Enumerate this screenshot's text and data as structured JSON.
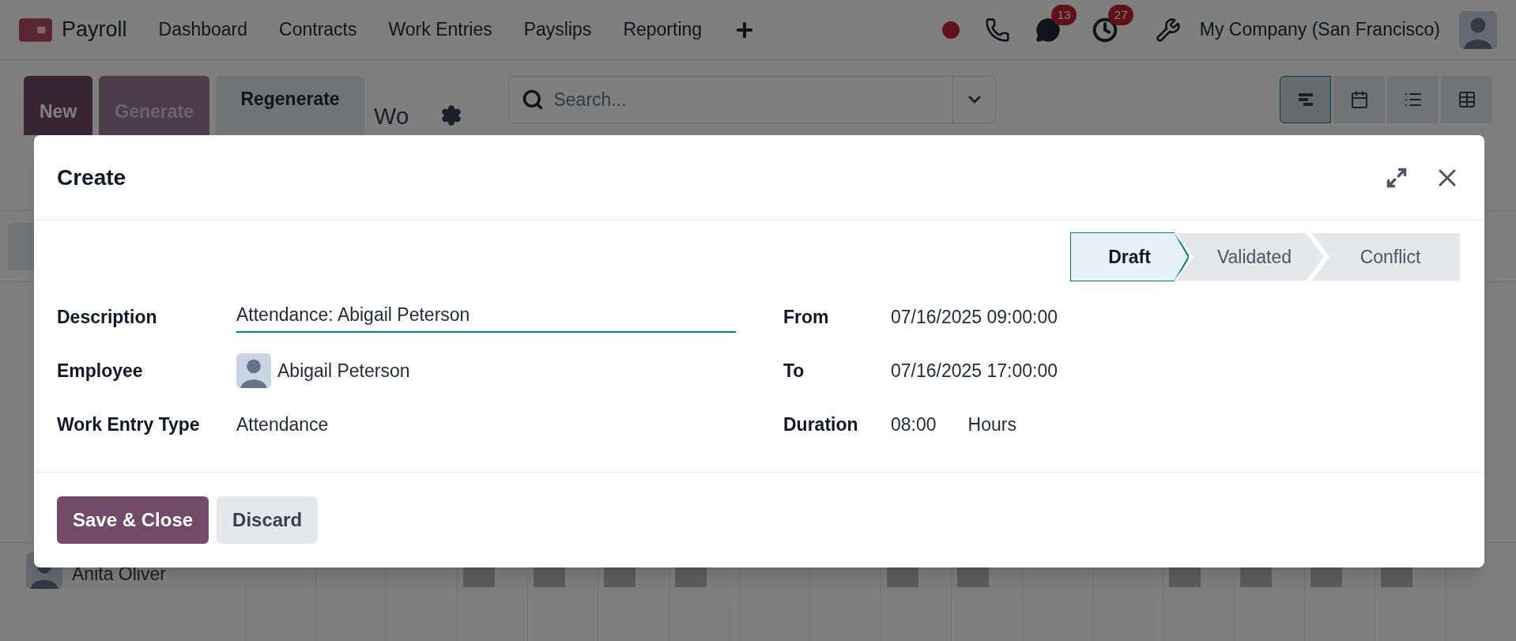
{
  "navbar": {
    "app_name": "Payroll",
    "menu": [
      {
        "label": "Dashboard"
      },
      {
        "label": "Contracts"
      },
      {
        "label": "Work Entries"
      },
      {
        "label": "Payslips"
      },
      {
        "label": "Reporting"
      }
    ],
    "messages_badge": "13",
    "activities_badge": "27",
    "company": "My Company (San Francisco)"
  },
  "control_panel": {
    "buttons": [
      {
        "label": "New",
        "kind": "primary",
        "disabled": false
      },
      {
        "label": "Generate",
        "kind": "primary",
        "disabled": true
      },
      {
        "label": "Regenerate",
        "kind": "secondary",
        "disabled": false
      }
    ],
    "breadcrumb": "Wo",
    "search": {
      "placeholder": "Search..."
    },
    "views": [
      {
        "kind": "gantt",
        "selected": true
      },
      {
        "kind": "calendar",
        "selected": false
      },
      {
        "kind": "list",
        "selected": false
      },
      {
        "kind": "pivot",
        "selected": false
      }
    ]
  },
  "gantt": {
    "rows": [
      {
        "name": "Anita Oliver",
        "bars": [
          false,
          false,
          false,
          true,
          true,
          true,
          true,
          false,
          false,
          true,
          true,
          false,
          false,
          true,
          true,
          true,
          true,
          false
        ]
      }
    ]
  },
  "dialog": {
    "title": "Create",
    "stages": [
      {
        "label": "Draft",
        "selected": true
      },
      {
        "label": "Validated",
        "selected": false
      },
      {
        "label": "Conflict",
        "selected": false
      }
    ],
    "left_fields": [
      {
        "label": "Description",
        "value": "Attendance: Abigail Peterson",
        "kind": "input"
      },
      {
        "label": "Employee",
        "value": "Abigail Peterson",
        "kind": "avatar"
      },
      {
        "label": "Work Entry Type",
        "value": "Attendance",
        "kind": "text"
      }
    ],
    "right_fields": [
      {
        "label": "From",
        "value": "07/16/2025 09:00:00"
      },
      {
        "label": "To",
        "value": "07/16/2025 17:00:00"
      },
      {
        "label": "Duration",
        "value": "08:00",
        "unit": "Hours"
      }
    ],
    "buttons": [
      {
        "label": "Save & Close",
        "kind": "primary"
      },
      {
        "label": "Discard",
        "kind": "secondary"
      }
    ]
  }
}
